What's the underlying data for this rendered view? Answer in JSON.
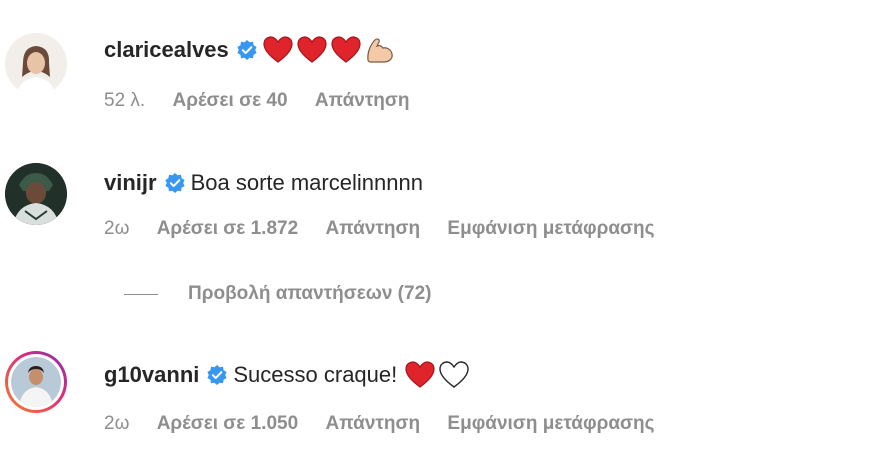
{
  "comments": [
    {
      "username": "claricealves",
      "text": "",
      "emojis": [
        "red-heart",
        "red-heart",
        "red-heart",
        "flexed-biceps"
      ],
      "time": "52 λ.",
      "likes": "Αρέσει σε 40",
      "reply": "Απάντηση",
      "translate": ""
    },
    {
      "username": "vinijr",
      "text": "Boa sorte marcelinnnnn",
      "emojis": [],
      "time": "2ω",
      "likes": "Αρέσει σε 1.872",
      "reply": "Απάντηση",
      "translate": "Εμφάνιση μετάφρασης"
    },
    {
      "username": "g10vanni",
      "text": "Sucesso craque!",
      "emojis": [
        "red-heart",
        "white-heart"
      ],
      "time": "2ω",
      "likes": "Αρέσει σε 1.050",
      "reply": "Απάντηση",
      "translate": "Εμφάνιση μετάφρασης"
    }
  ],
  "view_replies": "Προβολή απαντήσεων (72)",
  "colors": {
    "verified": "#3897f0",
    "heart": "#e0242c",
    "secondary_text": "#8e8e8e",
    "story_ring_start": "#f58529",
    "story_ring_end": "#dd2a7b"
  }
}
